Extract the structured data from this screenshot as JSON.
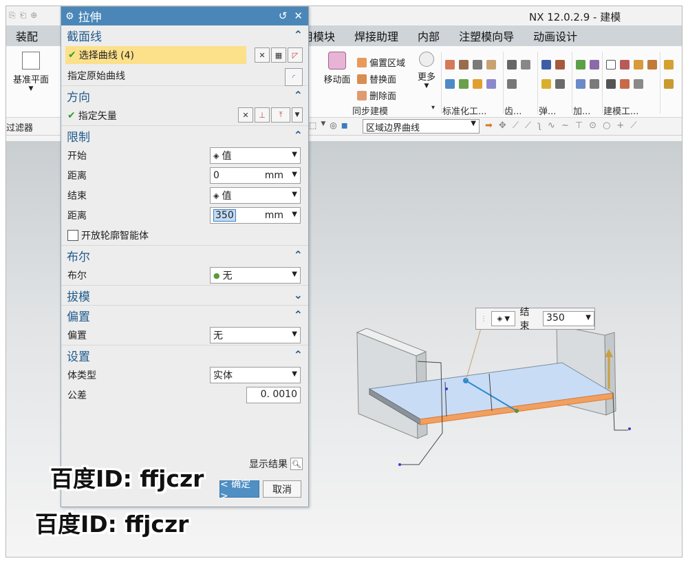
{
  "window": {
    "title": "NX 12.0.2.9 - 建模"
  },
  "menu": {
    "items": [
      "装配",
      "用模块",
      "焊接助理",
      "内部",
      "注塑模向导",
      "动画设计"
    ]
  },
  "ribbon": {
    "datum_plane": "基准平面",
    "offset_region": "偏置区域",
    "move_face": "移动面",
    "replace_face": "替换面",
    "delete_face": "删除面",
    "more": "更多",
    "group_sync": "同步建模",
    "group_standard": "标准化工...",
    "group_gear": "齿...",
    "group_spring": "弹...",
    "group_add": "加...",
    "group_model": "建模工..."
  },
  "selection_bar": {
    "filter_label": "过滤器",
    "region_combo": "区域边界曲线"
  },
  "dialog": {
    "title": "拉伸",
    "section_curve": {
      "title": "截面线",
      "select_curve": "选择曲线 (4)",
      "specify_origin": "指定原始曲线"
    },
    "section_direction": {
      "title": "方向",
      "specify_vector": "指定矢量"
    },
    "section_limits": {
      "title": "限制",
      "start_label": "开始",
      "start_value": "值",
      "distance1_label": "距离",
      "distance1_value": "0",
      "distance1_unit": "mm",
      "end_label": "结束",
      "end_value": "值",
      "distance2_label": "距离",
      "distance2_value": "350",
      "distance2_unit": "mm",
      "open_profile": "开放轮廓智能体"
    },
    "section_boolean": {
      "title": "布尔",
      "label": "布尔",
      "value": "无"
    },
    "section_draft": {
      "title": "拔模"
    },
    "section_offset": {
      "title": "偏置",
      "label": "偏置",
      "value": "无"
    },
    "section_settings": {
      "title": "设置",
      "body_type_label": "体类型",
      "body_type_value": "实体",
      "tolerance_label": "公差",
      "tolerance_value": "0. 0010"
    },
    "show_result": "显示结果",
    "ok": "< 确定 >",
    "cancel": "取消"
  },
  "floating_input": {
    "label": "结束",
    "value": "350"
  },
  "watermark": "百度ID: ffjczr",
  "colors": {
    "dialog_title_bg": "#4a87b8",
    "section_title": "#1f5a8c",
    "highlight_row": "#fce08a",
    "edge_highlight": "#f0a060"
  }
}
